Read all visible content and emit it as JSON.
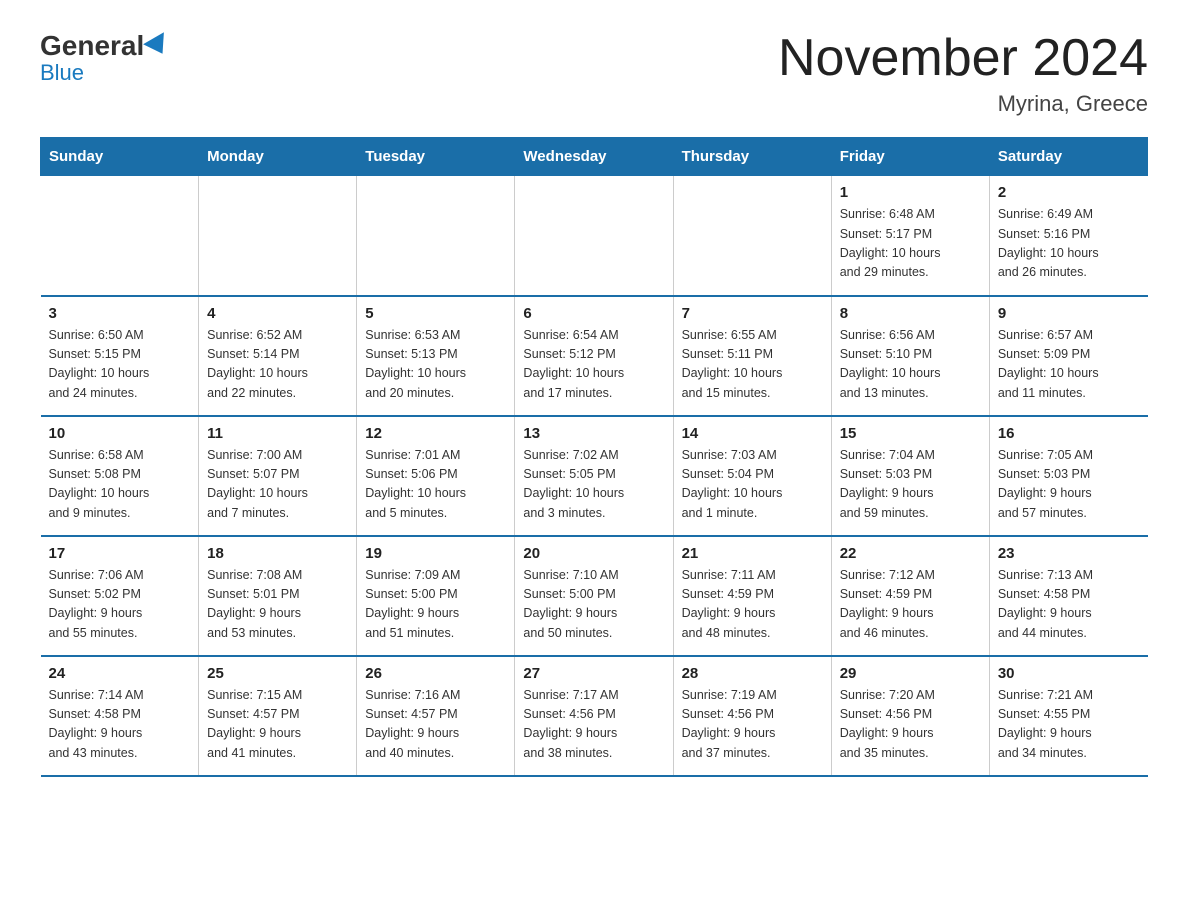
{
  "header": {
    "logo": {
      "general_text": "General",
      "blue_text": "Blue"
    },
    "month_title": "November 2024",
    "location": "Myrina, Greece"
  },
  "weekdays": [
    "Sunday",
    "Monday",
    "Tuesday",
    "Wednesday",
    "Thursday",
    "Friday",
    "Saturday"
  ],
  "weeks": [
    {
      "days": [
        {
          "number": "",
          "info": "",
          "empty": true
        },
        {
          "number": "",
          "info": "",
          "empty": true
        },
        {
          "number": "",
          "info": "",
          "empty": true
        },
        {
          "number": "",
          "info": "",
          "empty": true
        },
        {
          "number": "",
          "info": "",
          "empty": true
        },
        {
          "number": "1",
          "info": "Sunrise: 6:48 AM\nSunset: 5:17 PM\nDaylight: 10 hours\nand 29 minutes."
        },
        {
          "number": "2",
          "info": "Sunrise: 6:49 AM\nSunset: 5:16 PM\nDaylight: 10 hours\nand 26 minutes."
        }
      ]
    },
    {
      "days": [
        {
          "number": "3",
          "info": "Sunrise: 6:50 AM\nSunset: 5:15 PM\nDaylight: 10 hours\nand 24 minutes."
        },
        {
          "number": "4",
          "info": "Sunrise: 6:52 AM\nSunset: 5:14 PM\nDaylight: 10 hours\nand 22 minutes."
        },
        {
          "number": "5",
          "info": "Sunrise: 6:53 AM\nSunset: 5:13 PM\nDaylight: 10 hours\nand 20 minutes."
        },
        {
          "number": "6",
          "info": "Sunrise: 6:54 AM\nSunset: 5:12 PM\nDaylight: 10 hours\nand 17 minutes."
        },
        {
          "number": "7",
          "info": "Sunrise: 6:55 AM\nSunset: 5:11 PM\nDaylight: 10 hours\nand 15 minutes."
        },
        {
          "number": "8",
          "info": "Sunrise: 6:56 AM\nSunset: 5:10 PM\nDaylight: 10 hours\nand 13 minutes."
        },
        {
          "number": "9",
          "info": "Sunrise: 6:57 AM\nSunset: 5:09 PM\nDaylight: 10 hours\nand 11 minutes."
        }
      ]
    },
    {
      "days": [
        {
          "number": "10",
          "info": "Sunrise: 6:58 AM\nSunset: 5:08 PM\nDaylight: 10 hours\nand 9 minutes."
        },
        {
          "number": "11",
          "info": "Sunrise: 7:00 AM\nSunset: 5:07 PM\nDaylight: 10 hours\nand 7 minutes."
        },
        {
          "number": "12",
          "info": "Sunrise: 7:01 AM\nSunset: 5:06 PM\nDaylight: 10 hours\nand 5 minutes."
        },
        {
          "number": "13",
          "info": "Sunrise: 7:02 AM\nSunset: 5:05 PM\nDaylight: 10 hours\nand 3 minutes."
        },
        {
          "number": "14",
          "info": "Sunrise: 7:03 AM\nSunset: 5:04 PM\nDaylight: 10 hours\nand 1 minute."
        },
        {
          "number": "15",
          "info": "Sunrise: 7:04 AM\nSunset: 5:03 PM\nDaylight: 9 hours\nand 59 minutes."
        },
        {
          "number": "16",
          "info": "Sunrise: 7:05 AM\nSunset: 5:03 PM\nDaylight: 9 hours\nand 57 minutes."
        }
      ]
    },
    {
      "days": [
        {
          "number": "17",
          "info": "Sunrise: 7:06 AM\nSunset: 5:02 PM\nDaylight: 9 hours\nand 55 minutes."
        },
        {
          "number": "18",
          "info": "Sunrise: 7:08 AM\nSunset: 5:01 PM\nDaylight: 9 hours\nand 53 minutes."
        },
        {
          "number": "19",
          "info": "Sunrise: 7:09 AM\nSunset: 5:00 PM\nDaylight: 9 hours\nand 51 minutes."
        },
        {
          "number": "20",
          "info": "Sunrise: 7:10 AM\nSunset: 5:00 PM\nDaylight: 9 hours\nand 50 minutes."
        },
        {
          "number": "21",
          "info": "Sunrise: 7:11 AM\nSunset: 4:59 PM\nDaylight: 9 hours\nand 48 minutes."
        },
        {
          "number": "22",
          "info": "Sunrise: 7:12 AM\nSunset: 4:59 PM\nDaylight: 9 hours\nand 46 minutes."
        },
        {
          "number": "23",
          "info": "Sunrise: 7:13 AM\nSunset: 4:58 PM\nDaylight: 9 hours\nand 44 minutes."
        }
      ]
    },
    {
      "days": [
        {
          "number": "24",
          "info": "Sunrise: 7:14 AM\nSunset: 4:58 PM\nDaylight: 9 hours\nand 43 minutes."
        },
        {
          "number": "25",
          "info": "Sunrise: 7:15 AM\nSunset: 4:57 PM\nDaylight: 9 hours\nand 41 minutes."
        },
        {
          "number": "26",
          "info": "Sunrise: 7:16 AM\nSunset: 4:57 PM\nDaylight: 9 hours\nand 40 minutes."
        },
        {
          "number": "27",
          "info": "Sunrise: 7:17 AM\nSunset: 4:56 PM\nDaylight: 9 hours\nand 38 minutes."
        },
        {
          "number": "28",
          "info": "Sunrise: 7:19 AM\nSunset: 4:56 PM\nDaylight: 9 hours\nand 37 minutes."
        },
        {
          "number": "29",
          "info": "Sunrise: 7:20 AM\nSunset: 4:56 PM\nDaylight: 9 hours\nand 35 minutes."
        },
        {
          "number": "30",
          "info": "Sunrise: 7:21 AM\nSunset: 4:55 PM\nDaylight: 9 hours\nand 34 minutes."
        }
      ]
    }
  ]
}
